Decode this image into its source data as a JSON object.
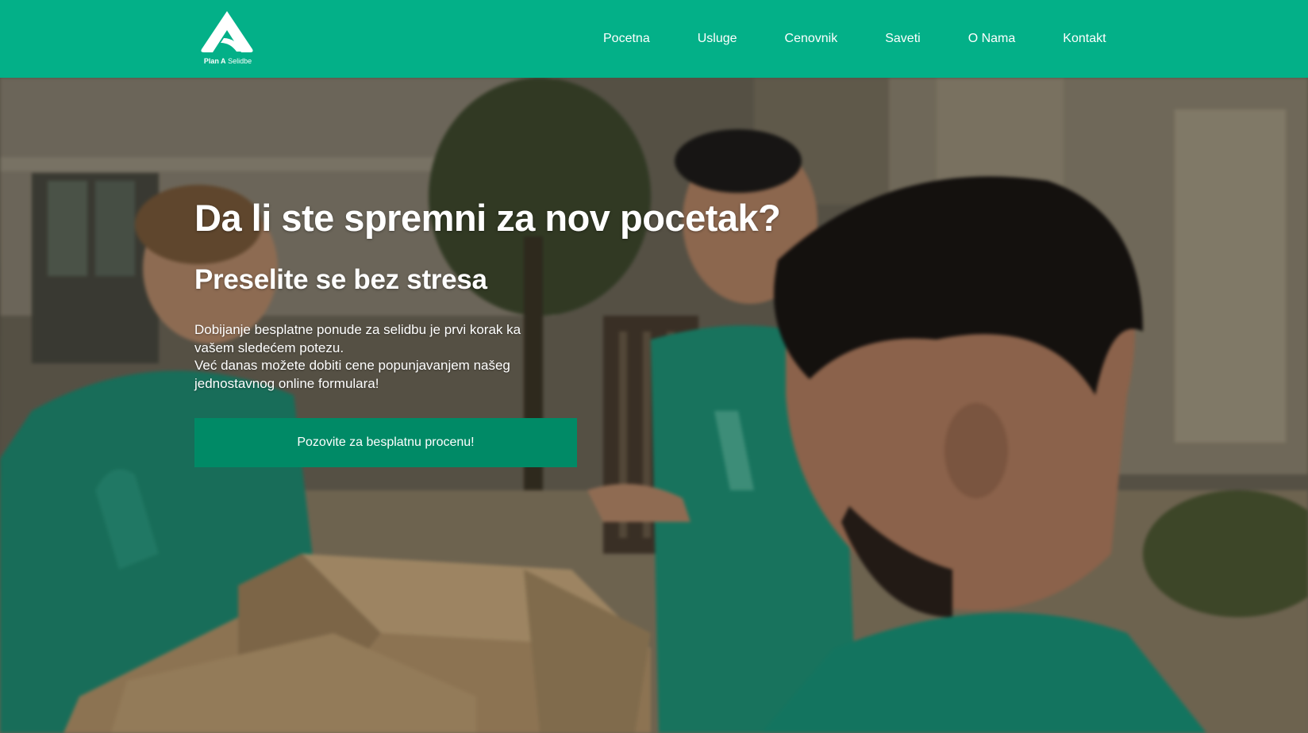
{
  "brand": {
    "name_bold": "Plan A",
    "name_light": "Selidbe",
    "icon": "plan-a-logo-icon",
    "primary_color": "#03b088",
    "button_color": "#008a66"
  },
  "nav": {
    "items": [
      {
        "label": "Pocetna"
      },
      {
        "label": "Usluge"
      },
      {
        "label": "Cenovnik"
      },
      {
        "label": "Saveti"
      },
      {
        "label": "O Nama"
      },
      {
        "label": "Kontakt"
      }
    ]
  },
  "hero": {
    "title": "Da li ste spremni za nov pocetak?",
    "subtitle": "Preselite se bez stresa",
    "paragraph_line1": "Dobijanje besplatne ponude za selidbu je prvi korak ka vašem sledećem potezu.",
    "paragraph_line2": "Već danas možete dobiti cene popunjavanjem našeg jednostavnog online formulara!",
    "cta_label": "Pozovite za besplatnu procenu!",
    "background": "movers-with-boxes-photo"
  }
}
